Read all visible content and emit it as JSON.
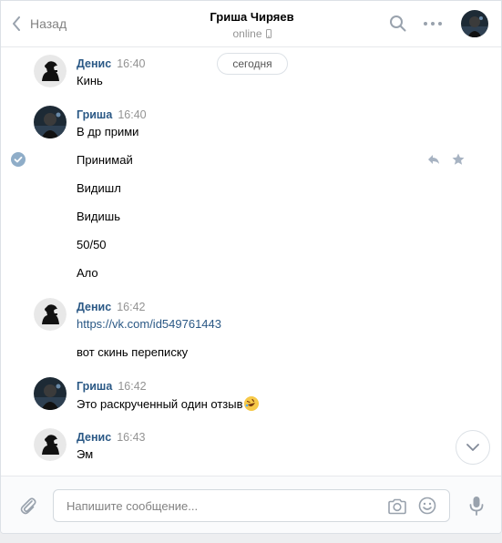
{
  "header": {
    "back_label": "Назад",
    "title": "Гриша Чиряев",
    "status": "online"
  },
  "history": {
    "date_label": "сегодня",
    "messages": [
      {
        "author": "Денис",
        "time": "16:40",
        "lines": [
          "Кинь"
        ]
      },
      {
        "author": "Гриша",
        "time": "16:40",
        "lines": [
          "В др прими",
          "Принимай",
          "Видишл",
          "Видишь",
          "50/50",
          "Ало"
        ]
      },
      {
        "author": "Денис",
        "time": "16:42",
        "lines": [
          "https://vk.com/id549761443",
          "вот скинь переписку"
        ]
      },
      {
        "author": "Гриша",
        "time": "16:42",
        "lines": [
          "Это раскрученный один отзыв"
        ]
      },
      {
        "author": "Денис",
        "time": "16:43",
        "lines": [
          "Эм"
        ]
      }
    ]
  },
  "composer": {
    "placeholder": "Напишите сообщение..."
  },
  "colors": {
    "author": "#2a5885",
    "link": "#2a5885",
    "muted": "#939393",
    "accent_check": "#8fadc8"
  }
}
